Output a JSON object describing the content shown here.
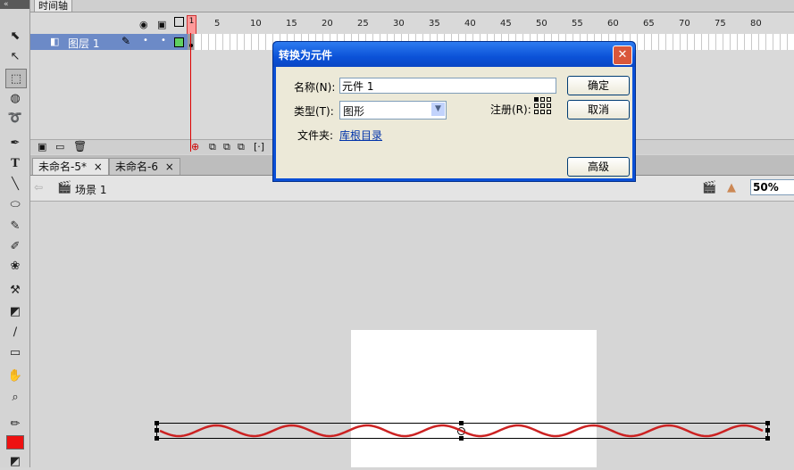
{
  "toolbar": {
    "collapse_label": "«",
    "tools": [
      "selection-tool",
      "subselection-tool",
      "free-transform-tool",
      "3d-rotation-tool",
      "lasso-tool",
      "pen-tool",
      "text-tool",
      "line-tool",
      "oval-tool",
      "pencil-tool",
      "brush-tool",
      "deco-tool",
      "bone-tool",
      "paint-bucket-tool",
      "eyedropper-tool",
      "eraser-tool",
      "hand-tool",
      "zoom-tool",
      "stroke-color-tool",
      "fill-color-tool"
    ],
    "stroke_color": "#333333",
    "fill_color": "#ee1111"
  },
  "timeline": {
    "tab_label": "时间轴",
    "ruler_numbers": [
      "1",
      "5",
      "10",
      "15",
      "20",
      "25",
      "30",
      "35",
      "40",
      "45",
      "50",
      "55",
      "60",
      "65",
      "70",
      "75",
      "80"
    ],
    "layer_name": "图层 1",
    "layer_color": "#6c8ac7"
  },
  "doc_tabs": [
    {
      "label": "未命名-5*",
      "close": "×"
    },
    {
      "label": "未命名-6",
      "close": "×"
    }
  ],
  "edit_bar": {
    "back_arrow": "⇦",
    "scene_label": "场景 1",
    "zoom_value": "50%"
  },
  "dialog": {
    "title": "转换为元件",
    "close_label": "✕",
    "name_label": "名称(N):",
    "name_value": "元件 1",
    "type_label": "类型(T):",
    "type_value": "图形",
    "registration_label": "注册(R):",
    "folder_label": "文件夹:",
    "folder_link": "库根目录",
    "ok_label": "确定",
    "cancel_label": "取消",
    "advanced_label": "高级"
  },
  "stage": {
    "wave_color": "#cc2222"
  }
}
